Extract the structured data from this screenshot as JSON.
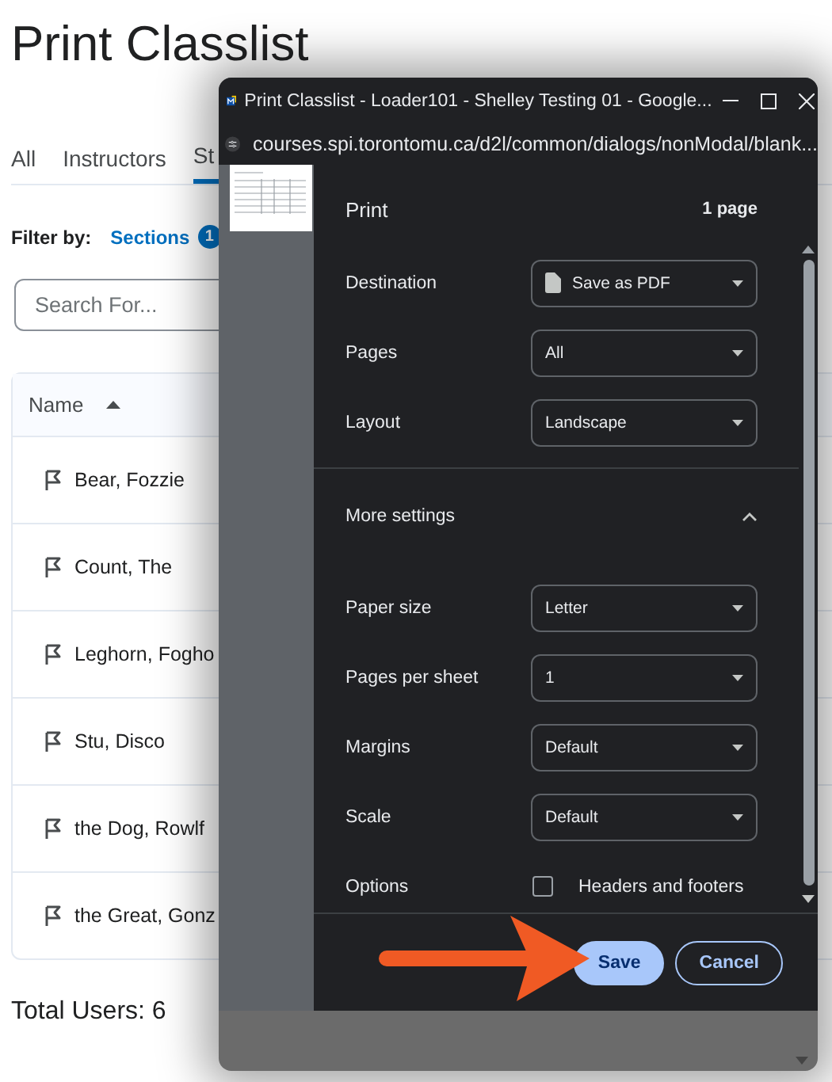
{
  "page": {
    "title": "Print Classlist",
    "tabs": [
      {
        "label": "All",
        "selected": false
      },
      {
        "label": "Instructors",
        "selected": false
      },
      {
        "label": "St",
        "selected": true
      }
    ],
    "filter": {
      "label": "Filter by:",
      "link": "Sections",
      "count": "1"
    },
    "search": {
      "placeholder": "Search For..."
    },
    "table": {
      "column": {
        "label": "Name"
      },
      "rows": [
        "Bear, Fozzie",
        "Count, The",
        "Leghorn, Fogho",
        "Stu, Disco",
        "the Dog, Rowlf",
        "the Great, Gonz"
      ]
    },
    "total": "Total Users: 6"
  },
  "print_window": {
    "title": "Print Classlist - Loader101 - Shelley Testing 01 - Google...",
    "url": "courses.spi.torontomu.ca/d2l/common/dialogs/nonModal/blank...",
    "heading": "Print",
    "page_count": "1 page",
    "settings": [
      {
        "kind": "destination",
        "label": "Destination",
        "value": "Save as PDF"
      },
      {
        "kind": "select",
        "label": "Pages",
        "value": "All"
      },
      {
        "kind": "select",
        "label": "Layout",
        "value": "Landscape"
      }
    ],
    "more_settings": {
      "label": "More settings",
      "expanded": true
    },
    "more": [
      {
        "kind": "select",
        "label": "Paper size",
        "value": "Letter"
      },
      {
        "kind": "select",
        "label": "Pages per sheet",
        "value": "1"
      },
      {
        "kind": "select",
        "label": "Margins",
        "value": "Default"
      },
      {
        "kind": "select",
        "label": "Scale",
        "value": "Default"
      },
      {
        "kind": "checkbox",
        "label": "Options",
        "value": "Headers and footers",
        "checked": false
      }
    ],
    "buttons": [
      {
        "label": "Save",
        "primary": true
      },
      {
        "label": "Cancel",
        "primary": false
      }
    ]
  }
}
